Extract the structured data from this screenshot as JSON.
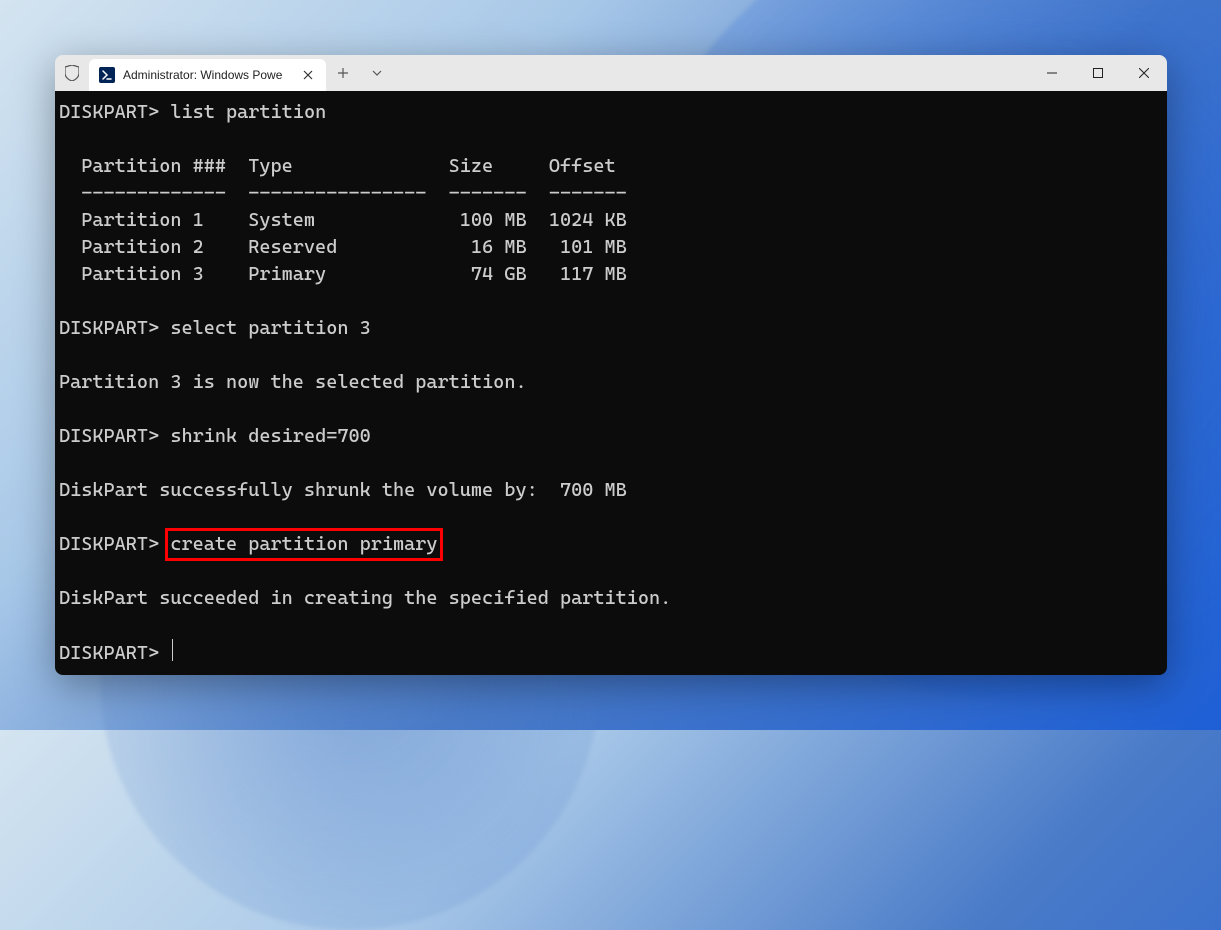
{
  "tab": {
    "title": "Administrator: Windows Powe"
  },
  "terminal": {
    "prompt": "DISKPART>",
    "lines": {
      "l1_cmd": "list partition",
      "header": "  Partition ###  Type              Size     Offset",
      "rule": "  -------------  ----------------  -------  -------",
      "p1": "  Partition 1    System             100 MB  1024 KB",
      "p2": "  Partition 2    Reserved            16 MB   101 MB",
      "p3": "  Partition 3    Primary             74 GB   117 MB",
      "l2_cmd": "select partition 3",
      "l2_resp": "Partition 3 is now the selected partition.",
      "l3_cmd": "shrink desired=700",
      "l3_resp": "DiskPart successfully shrunk the volume by:  700 MB",
      "l4_cmd": "create partition primary",
      "l4_resp": "DiskPart succeeded in creating the specified partition."
    }
  }
}
